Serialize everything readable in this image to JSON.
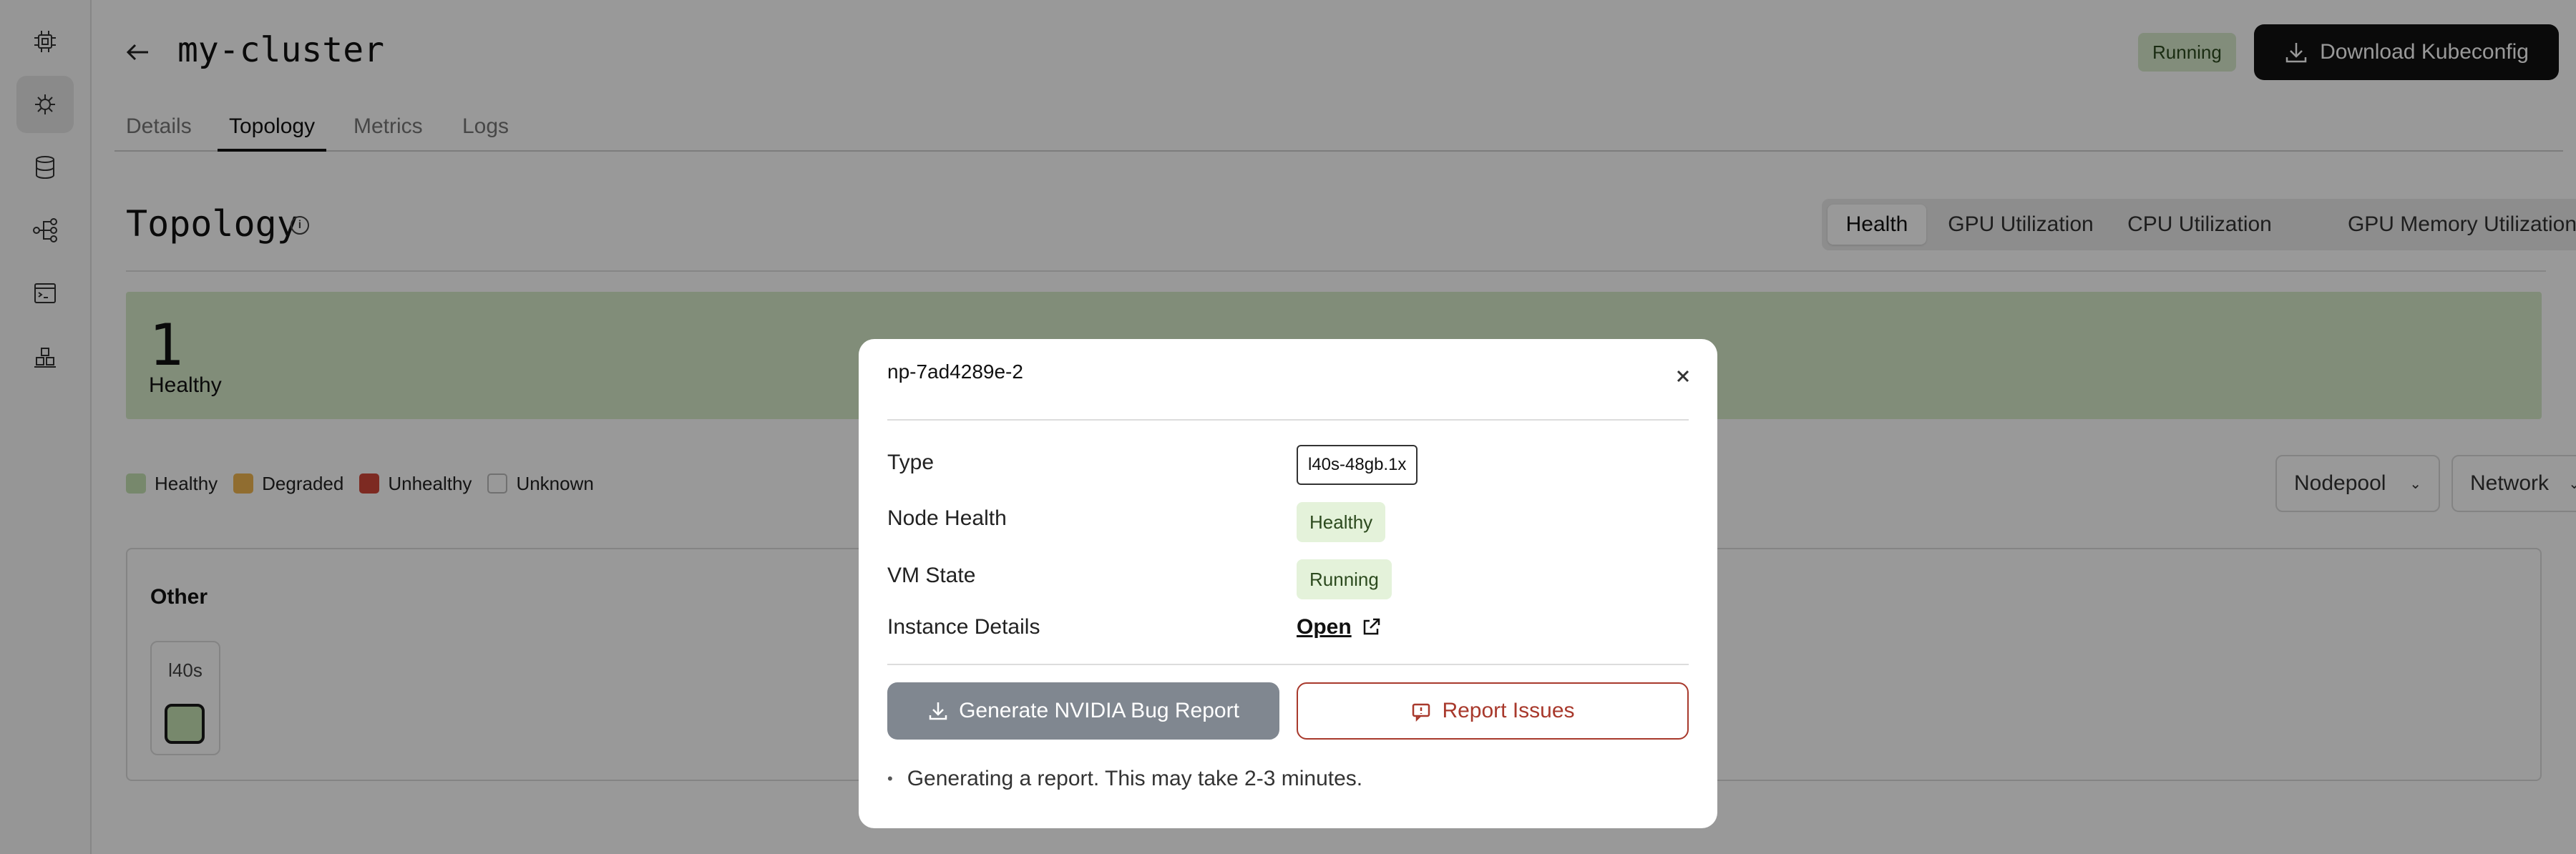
{
  "header": {
    "cluster_name": "my-cluster",
    "status": "Running",
    "download_label": "Download Kubeconfig"
  },
  "tabs": [
    {
      "label": "Details"
    },
    {
      "label": "Topology"
    },
    {
      "label": "Metrics"
    },
    {
      "label": "Logs"
    }
  ],
  "active_tab": "Topology",
  "topology": {
    "title": "Topology",
    "views": [
      {
        "label": "Health"
      },
      {
        "label": "GPU Utilization"
      },
      {
        "label": "CPU Utilization"
      },
      {
        "label": "GPU Memory Utilization"
      }
    ],
    "active_view": "Health",
    "health_count": "1",
    "health_label": "Healthy",
    "legend": [
      {
        "label": "Healthy",
        "color": "#c7e3b5"
      },
      {
        "label": "Degraded",
        "color": "#f1b650"
      },
      {
        "label": "Unhealthy",
        "color": "#d0473a"
      },
      {
        "label": "Unknown",
        "color": "#ffffff"
      }
    ],
    "filters": {
      "nodepool": "Nodepool",
      "network": "Network"
    },
    "group": {
      "title": "Other",
      "node_type": "l40s"
    }
  },
  "modal": {
    "title": "np-7ad4289e-2",
    "type_label": "Type",
    "type_value": "l40s-48gb.1x",
    "health_label": "Node Health",
    "health_value": "Healthy",
    "vm_label": "VM State",
    "vm_value": "Running",
    "instance_label": "Instance Details",
    "instance_link": "Open",
    "generate_label": "Generate NVIDIA Bug Report",
    "report_label": "Report Issues",
    "note": "Generating a report. This may take 2-3 minutes."
  },
  "colors": {
    "healthy_bg": "#d7ebca",
    "accent_dark": "#111111",
    "danger": "#a8392c"
  }
}
